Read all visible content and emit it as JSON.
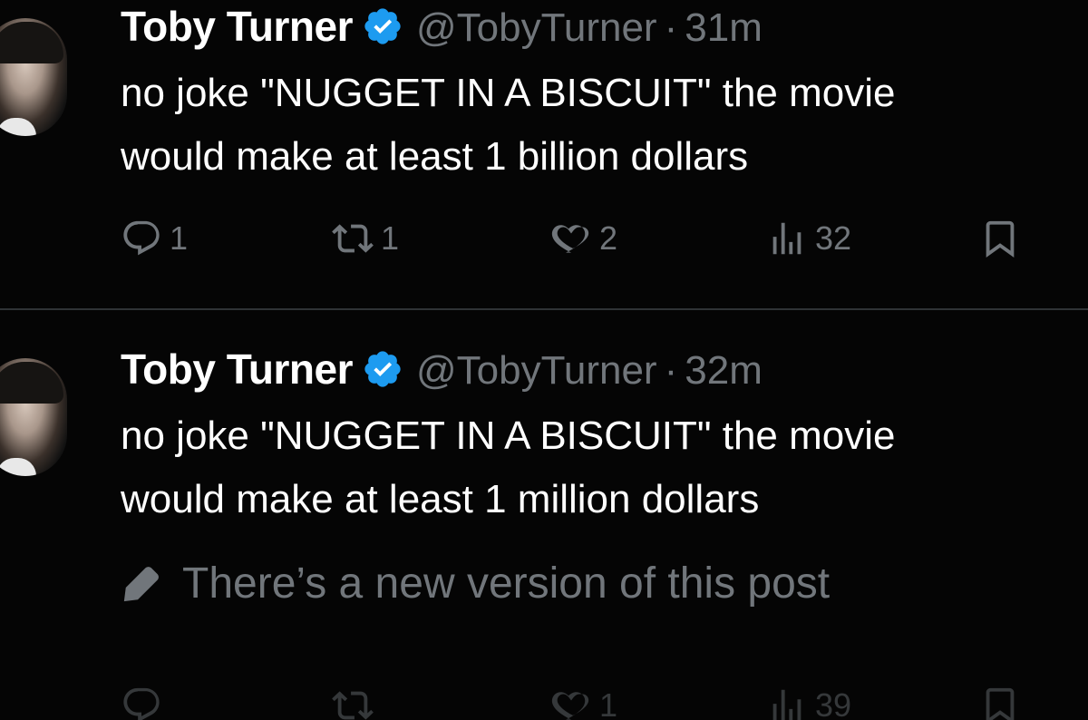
{
  "tweets": [
    {
      "author": {
        "display_name": "Toby Turner",
        "handle": "@TobyTurner",
        "verified": true
      },
      "separator": "·",
      "time": "31m",
      "body_lines": [
        "no joke \"NUGGET IN A BISCUIT\" the movie",
        "would make at least 1 billion dollars"
      ],
      "actions": {
        "replies": "1",
        "reposts": "1",
        "likes": "2",
        "views": "32"
      }
    },
    {
      "author": {
        "display_name": "Toby Turner",
        "handle": "@TobyTurner",
        "verified": true
      },
      "separator": "·",
      "time": "32m",
      "body_lines": [
        "no joke \"NUGGET IN A BISCUIT\" the movie",
        "would make at least 1 million dollars"
      ],
      "notice": "There’s a new version of this post",
      "actions": {
        "replies": "",
        "reposts": "",
        "likes": "1",
        "views": "39"
      }
    }
  ],
  "icons": {
    "verified": "verified-badge-icon",
    "reply": "reply-icon",
    "repost": "repost-icon",
    "like": "heart-icon",
    "views": "views-icon",
    "bookmark": "bookmark-icon",
    "edit": "pencil-icon"
  },
  "colors": {
    "background": "#000000",
    "text": "#ffffff",
    "secondary": "#71767b",
    "verified": "#1d9bf0"
  }
}
